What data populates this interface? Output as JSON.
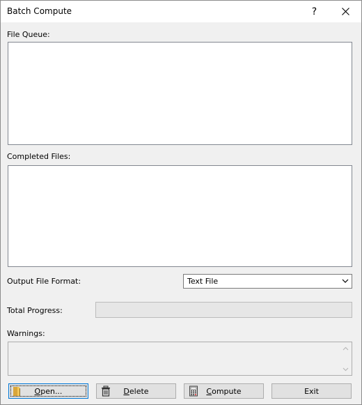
{
  "window": {
    "title": "Batch Compute",
    "help_label": "?",
    "close_label": "✕"
  },
  "file_queue": {
    "label": "File Queue:",
    "items": []
  },
  "completed_files": {
    "label": "Completed Files:",
    "items": []
  },
  "output_format": {
    "label": "Output File Format:",
    "selected": "Text File"
  },
  "total_progress": {
    "label": "Total Progress:",
    "value": 0
  },
  "warnings": {
    "label": "Warnings:",
    "text": ""
  },
  "buttons": {
    "open_mnemonic": "O",
    "open_rest": "pen...",
    "delete_mnemonic": "D",
    "delete_rest": "elete",
    "compute_mnemonic": "C",
    "compute_rest": "ompute",
    "exit_label": "Exit"
  },
  "icons": {
    "open": "open-folder-icon",
    "delete": "trash-icon",
    "compute": "calculator-icon"
  }
}
